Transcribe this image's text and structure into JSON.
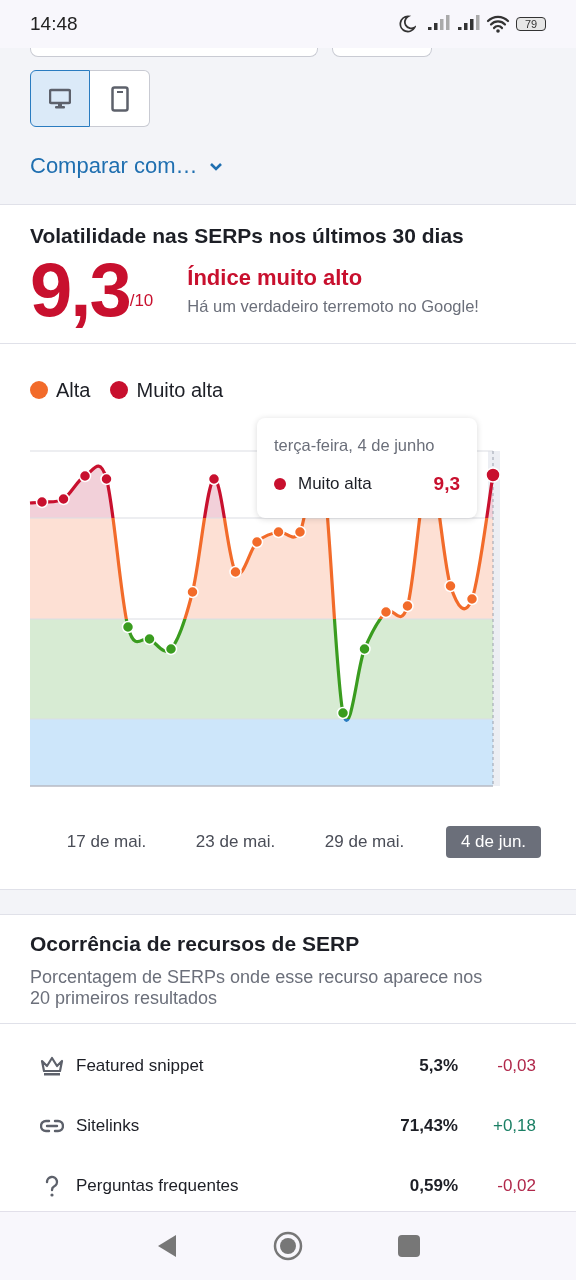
{
  "status_bar": {
    "time": "14:48",
    "battery": "79"
  },
  "device_toggle": [
    {
      "kind": "desktop",
      "selected": true
    },
    {
      "kind": "mobile",
      "selected": false
    }
  ],
  "compare_link": "Comparar com…",
  "volatility": {
    "title": "Volatilidade nas SERPs nos últimos 30 dias",
    "score": "9,3",
    "scale": "/10",
    "level_title": "Índice muito alto",
    "description": "Há um verdadeiro terremoto no Google!"
  },
  "chart": {
    "legend": [
      {
        "label": "Alta",
        "color": "#f26b2a"
      },
      {
        "label": "Muito alta",
        "color": "#c8102e"
      }
    ],
    "tooltip": {
      "date": "terça-feira, 4 de junho",
      "series": "Muito alta",
      "color": "#c8102e",
      "value": "9,3"
    },
    "x_labels": [
      {
        "label": "17 de mai.",
        "selected": false
      },
      {
        "label": "23 de mai.",
        "selected": false
      },
      {
        "label": "29 de mai.",
        "selected": false
      },
      {
        "label": "4 de jun.",
        "selected": true
      }
    ]
  },
  "features": {
    "title": "Ocorrência de recursos de SERP",
    "subtitle": "Porcentagem de SERPs onde esse recurso aparece nos 20 primeiros resultados",
    "rows": [
      {
        "kind": "crown",
        "name": "Featured snippet",
        "share": "5,3%",
        "change": "-0,03",
        "color": "#b0274a"
      },
      {
        "kind": "link",
        "name": "Sitelinks",
        "share": "71,43%",
        "change": "+0,18",
        "color": "#1a7f64"
      },
      {
        "kind": "question",
        "name": "Perguntas frequentes",
        "share": "0,59%",
        "change": "-0,02",
        "color": "#b0274a"
      }
    ]
  }
}
